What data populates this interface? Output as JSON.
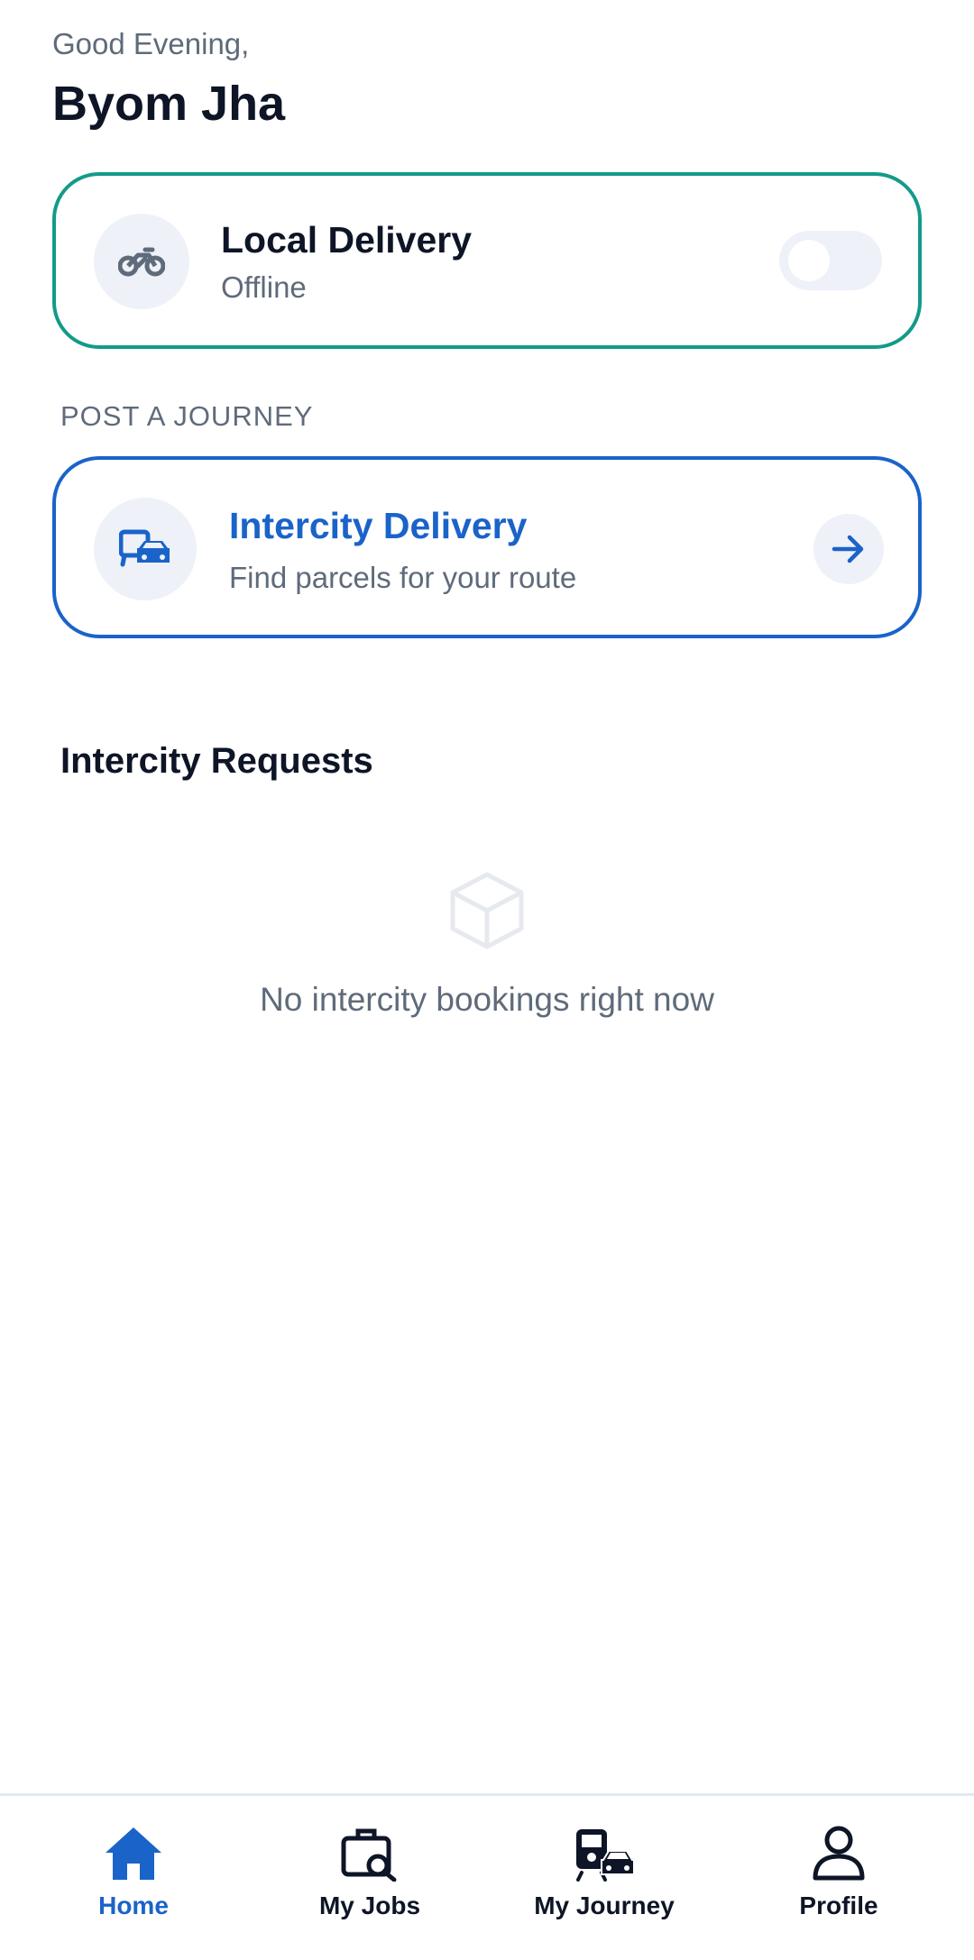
{
  "header": {
    "greeting": "Good Evening,",
    "username": "Byom Jha"
  },
  "local_delivery": {
    "icon": "motorbike-icon",
    "title": "Local Delivery",
    "status": "Offline",
    "toggle_on": false
  },
  "post_journey": {
    "section_label": "POST A JOURNEY",
    "icon": "bus-car-icon",
    "title": "Intercity Delivery",
    "subtitle": "Find parcels for your route",
    "action_icon": "arrow-right-icon"
  },
  "requests": {
    "title": "Intercity Requests",
    "empty_icon": "package-box-icon",
    "empty_text": "No intercity bookings right now"
  },
  "bottom_nav": {
    "items": [
      {
        "label": "Home",
        "icon": "home-icon",
        "active": true
      },
      {
        "label": "My Jobs",
        "icon": "briefcase-search-icon",
        "active": false
      },
      {
        "label": "My Journey",
        "icon": "train-car-icon",
        "active": false
      },
      {
        "label": "Profile",
        "icon": "user-icon",
        "active": false
      }
    ]
  },
  "colors": {
    "accent": "#1a63c9",
    "teal_border": "#139a8a",
    "muted_text": "#5f6b7a",
    "dark_text": "#0d1526",
    "icon_bg": "#eef1f8"
  }
}
